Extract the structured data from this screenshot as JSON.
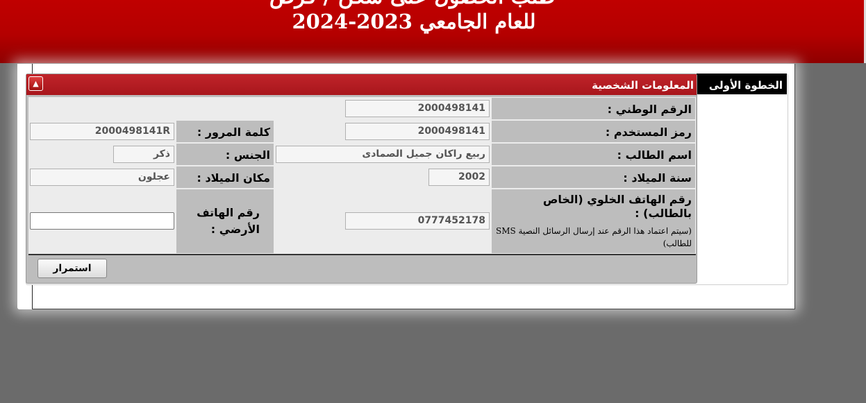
{
  "banner": {
    "title_partial": "طلب الحصول على سكن / قرض",
    "academic_year": "للعام الجامعي 2023-2024"
  },
  "step": {
    "label": "الخطوة الأولى"
  },
  "section": {
    "title": "المعلومات الشخصية",
    "collapse_icon": "triangle-up-icon"
  },
  "fields": {
    "national_id": {
      "label": "الرقم الوطني :",
      "value": "2000498141"
    },
    "username": {
      "label": "رمز المستخدم :",
      "value": "2000498141"
    },
    "password": {
      "label": "كلمة المرور :",
      "value": "2000498141R"
    },
    "student_name": {
      "label": "اسم الطالب :",
      "value": "ربيع راكان جميل الصمادى"
    },
    "gender": {
      "label": "الجنس :",
      "value": "ذكر"
    },
    "birth_year": {
      "label": "سنة الميلاد :",
      "value": "2002"
    },
    "birth_place": {
      "label": "مكان الميلاد :",
      "value": "عجلون"
    },
    "mobile": {
      "label": "رقم الهاتف الخلوي (الخاص بالطالب) :",
      "note": "(سيتم اعتماد هذا الرقم عند إرسال الرسائل النصية SMS للطالب)",
      "value": "0777452178"
    },
    "landline": {
      "label": "رقم الهاتف الأرضي :",
      "value": ""
    }
  },
  "actions": {
    "continue_label": "استمرار"
  },
  "colors": {
    "banner_red": "#b40000",
    "header_red": "#b0181e",
    "page_gray": "#6b6b6b"
  }
}
